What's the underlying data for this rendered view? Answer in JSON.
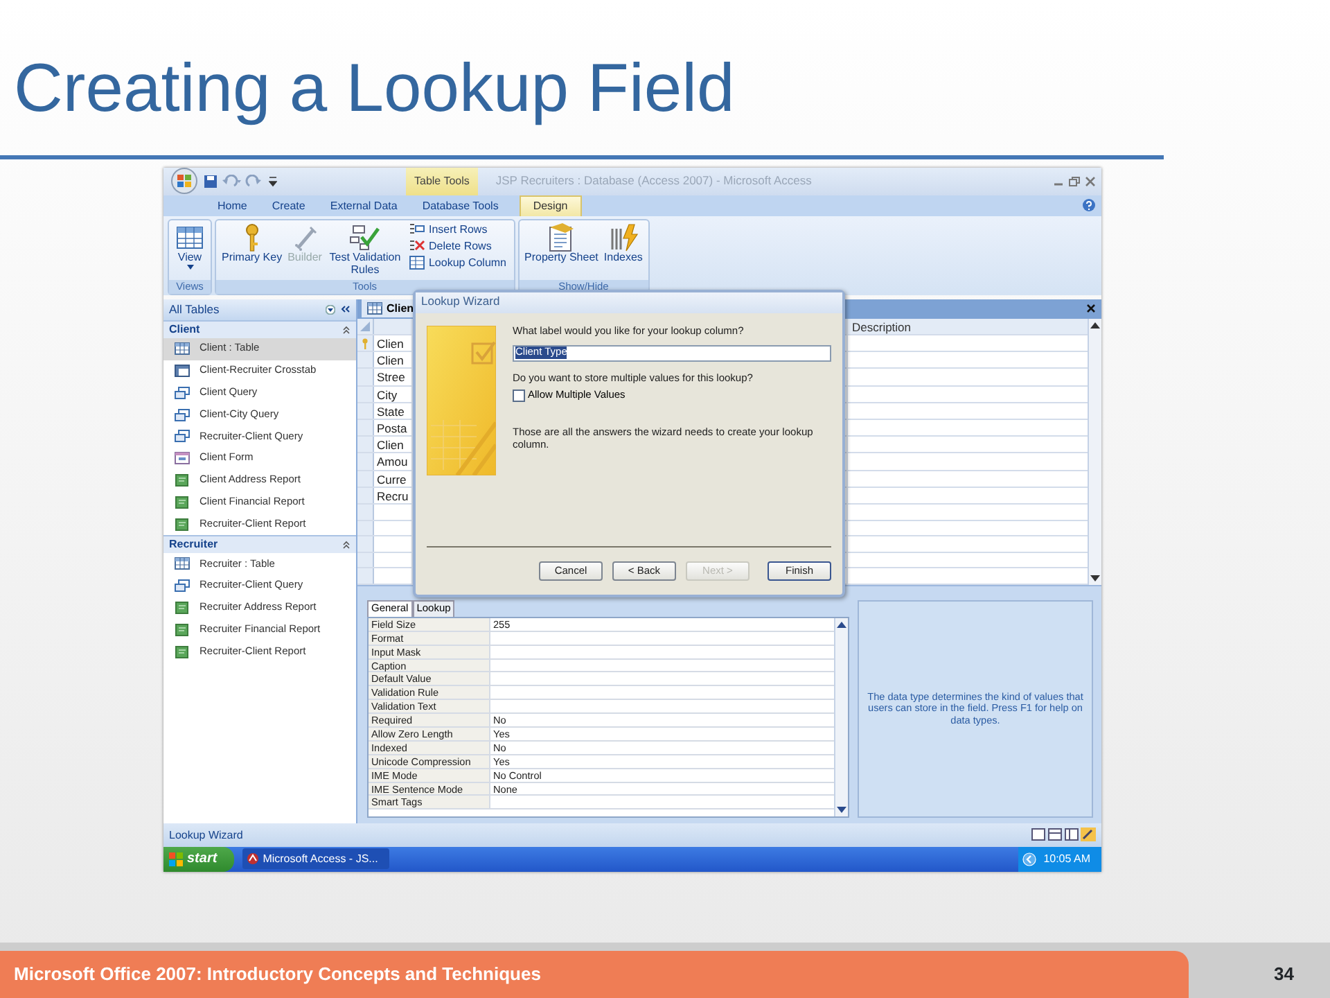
{
  "slide_title": "Creating a Lookup Field",
  "access_window": {
    "contextual_tab_label": "Table Tools",
    "window_title": "JSP Recruiters : Database (Access 2007) - Microsoft Access",
    "tabs": [
      {
        "label": "Home",
        "selected": false
      },
      {
        "label": "Create",
        "selected": false
      },
      {
        "label": "External Data",
        "selected": false
      },
      {
        "label": "Database Tools",
        "selected": false
      },
      {
        "label": "Design",
        "selected": true
      }
    ],
    "ribbon": [
      {
        "label": "Views",
        "buttons": [
          {
            "kind": "large",
            "label": "View",
            "dropdown": true,
            "disabled": false
          }
        ]
      },
      {
        "label": "Tools",
        "buttons": [
          {
            "kind": "large",
            "label": "Primary Key",
            "disabled": false
          },
          {
            "kind": "large",
            "label": "Builder",
            "disabled": true
          },
          {
            "kind": "large",
            "label": "Test Validation Rules",
            "disabled": false
          },
          {
            "kind": "small",
            "label": "Insert Rows",
            "disabled": false
          },
          {
            "kind": "small",
            "label": "Delete Rows",
            "disabled": false
          },
          {
            "kind": "small",
            "label": "Lookup Column",
            "disabled": false
          }
        ]
      },
      {
        "label": "Show/Hide",
        "buttons": [
          {
            "kind": "large",
            "label": "Property Sheet",
            "disabled": false
          },
          {
            "kind": "large",
            "label": "Indexes",
            "disabled": false
          }
        ]
      }
    ],
    "nav_pane": {
      "header": "All Tables",
      "groups": [
        {
          "label": "Client",
          "items": [
            {
              "label": "Client : Table",
              "kind": "table",
              "selected": true
            },
            {
              "label": "Client-Recruiter Crosstab",
              "kind": "crosstab",
              "selected": false
            },
            {
              "label": "Client Query",
              "kind": "query",
              "selected": false
            },
            {
              "label": "Client-City Query",
              "kind": "query",
              "selected": false
            },
            {
              "label": "Recruiter-Client Query",
              "kind": "query",
              "selected": false
            },
            {
              "label": "Client Form",
              "kind": "form",
              "selected": false
            },
            {
              "label": "Client Address Report",
              "kind": "report",
              "selected": false
            },
            {
              "label": "Client Financial Report",
              "kind": "report",
              "selected": false
            },
            {
              "label": "Recruiter-Client Report",
              "kind": "report",
              "selected": false
            }
          ]
        },
        {
          "label": "Recruiter",
          "items": [
            {
              "label": "Recruiter : Table",
              "kind": "table",
              "selected": false
            },
            {
              "label": "Recruiter-Client Query",
              "kind": "query",
              "selected": false
            },
            {
              "label": "Recruiter Address Report",
              "kind": "report",
              "selected": false
            },
            {
              "label": "Recruiter Financial Report",
              "kind": "report",
              "selected": false
            },
            {
              "label": "Recruiter-Client Report",
              "kind": "report",
              "selected": false
            }
          ]
        }
      ]
    },
    "document": {
      "tab_label": "Clien",
      "description_header": "Description",
      "fields": [
        {
          "name": "Clien",
          "primary_key": true
        },
        {
          "name": "Clien",
          "primary_key": false
        },
        {
          "name": "Stree",
          "primary_key": false
        },
        {
          "name": "City",
          "primary_key": false
        },
        {
          "name": "State",
          "primary_key": false
        },
        {
          "name": "Posta",
          "primary_key": false
        },
        {
          "name": "Clien",
          "primary_key": false
        },
        {
          "name": "Amou",
          "primary_key": false
        },
        {
          "name": "Curre",
          "primary_key": false
        },
        {
          "name": "Recru",
          "primary_key": false
        }
      ]
    },
    "field_properties": {
      "tabs": [
        {
          "label": "General",
          "selected": true
        },
        {
          "label": "Lookup",
          "selected": false
        }
      ],
      "rows": [
        {
          "name": "Field Size",
          "value": "255"
        },
        {
          "name": "Format"
        },
        {
          "name": "Input Mask"
        },
        {
          "name": "Caption"
        },
        {
          "name": "Default Value"
        },
        {
          "name": "Validation Rule"
        },
        {
          "name": "Validation Text"
        },
        {
          "name": "Required",
          "value": "No"
        },
        {
          "name": "Allow Zero Length",
          "value": "Yes"
        },
        {
          "name": "Indexed",
          "value": "No"
        },
        {
          "name": "Unicode Compression",
          "value": "Yes"
        },
        {
          "name": "IME Mode",
          "value": "No Control"
        },
        {
          "name": "IME Sentence Mode",
          "value": "None"
        },
        {
          "name": "Smart Tags"
        }
      ],
      "help": "The data type determines the kind of values that users can store in the field.  Press F1 for help on data types."
    },
    "dialog": {
      "title": "Lookup Wizard",
      "question": "What label would you like for your lookup column?",
      "label_value": "Client Type",
      "text_selected": true,
      "multi_question": "Do you want to store multiple values for this lookup?",
      "allow_multiple": {
        "label": "Allow Multiple Values",
        "checked": false
      },
      "info": "Those are all the answers the wizard needs to create your lookup column.",
      "buttons": [
        {
          "label": "Cancel",
          "disabled": false,
          "default": false
        },
        {
          "label": "< Back",
          "disabled": false,
          "default": false
        },
        {
          "label": "Next >",
          "disabled": true,
          "default": false
        },
        {
          "label": "Finish",
          "disabled": false,
          "default": true
        }
      ]
    },
    "status_bar": {
      "text": "Lookup Wizard"
    },
    "taskbar": {
      "start": "start",
      "task": "Microsoft Access - JS...",
      "clock": "10:05 AM"
    }
  },
  "footer": {
    "text": "Microsoft Office 2007: Introductory Concepts and Techniques",
    "page_number": "34"
  }
}
